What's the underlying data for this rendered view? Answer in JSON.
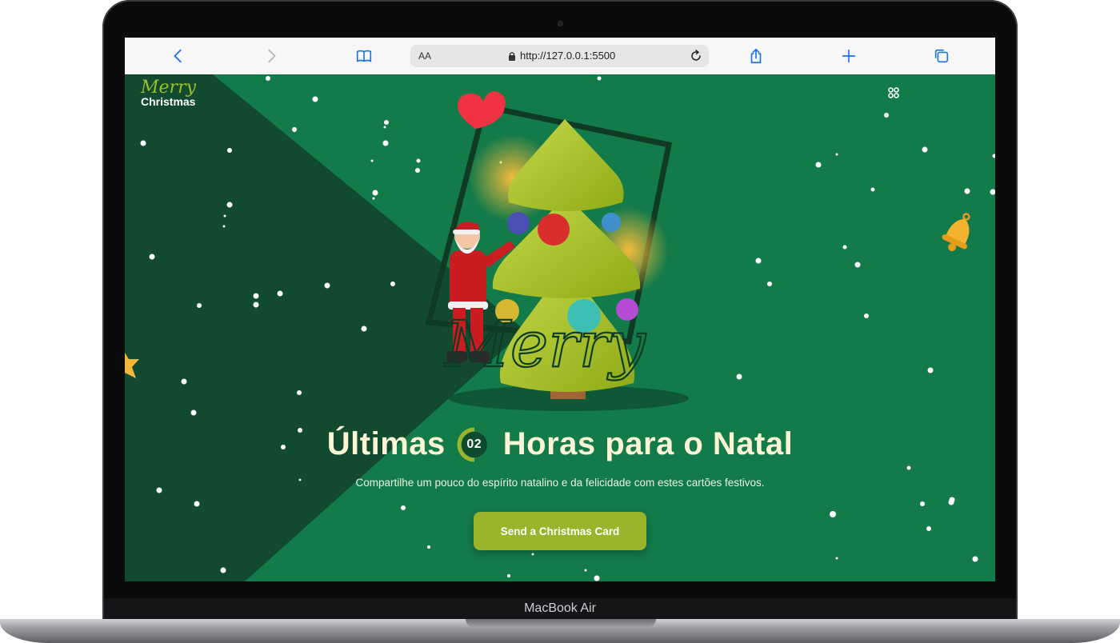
{
  "device": {
    "label": "MacBook Air"
  },
  "browser": {
    "text_size": "AA",
    "url": "http://127.0.0.1:5500",
    "icons": [
      "back-icon",
      "forward-icon",
      "bookmarks-icon",
      "lock-icon",
      "reload-icon",
      "share-icon",
      "new-tab-icon",
      "tabs-icon"
    ]
  },
  "logo": {
    "script": "Merry",
    "word": "Christmas"
  },
  "hero": {
    "script_word": "Merry",
    "title_before": "Últimas",
    "count": "02",
    "title_after": "Horas para o Natal",
    "subtitle": "Compartilhe um pouco do espírito natalino e da felicidade com estes cartões festivos.",
    "cta_label": "Send a Christmas Card"
  },
  "colors": {
    "page_green": "#137a4a",
    "dark_green": "#114a2f",
    "accent_lime": "#9ab42b",
    "title_cream": "#fbf5d6",
    "browser_accent": "#1a73e8"
  }
}
